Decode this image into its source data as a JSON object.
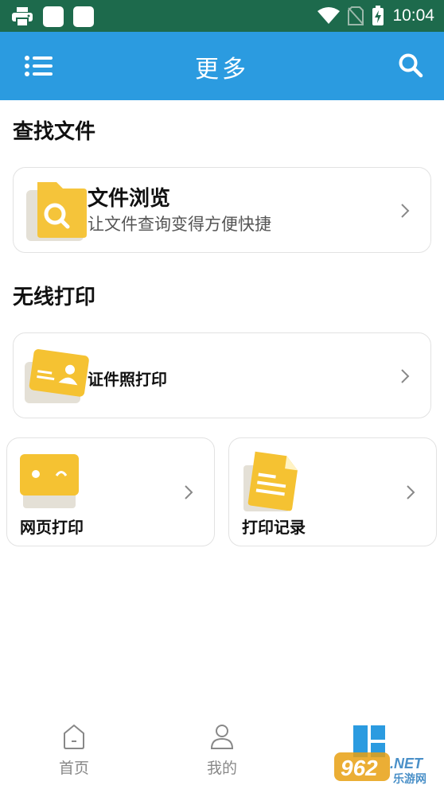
{
  "status_bar": {
    "time": "10:04"
  },
  "app_bar": {
    "title": "更多"
  },
  "sections": {
    "find_files": "查找文件",
    "wireless_print": "无线打印"
  },
  "cards": {
    "file_browse": {
      "title": "文件浏览",
      "subtitle": "让文件查询变得方便快捷"
    },
    "id_photo": {
      "title": "证件照打印"
    },
    "web_print": {
      "title": "网页打印"
    },
    "print_records": {
      "title": "打印记录"
    }
  },
  "bottom_nav": {
    "home": "首页",
    "mine": "我的"
  },
  "watermark": "962.NET 乐游网",
  "colors": {
    "status_bar": "#1d6a4c",
    "app_bar": "#2b9be0",
    "accent_yellow": "#f5c232",
    "nav_gray": "#888888"
  }
}
